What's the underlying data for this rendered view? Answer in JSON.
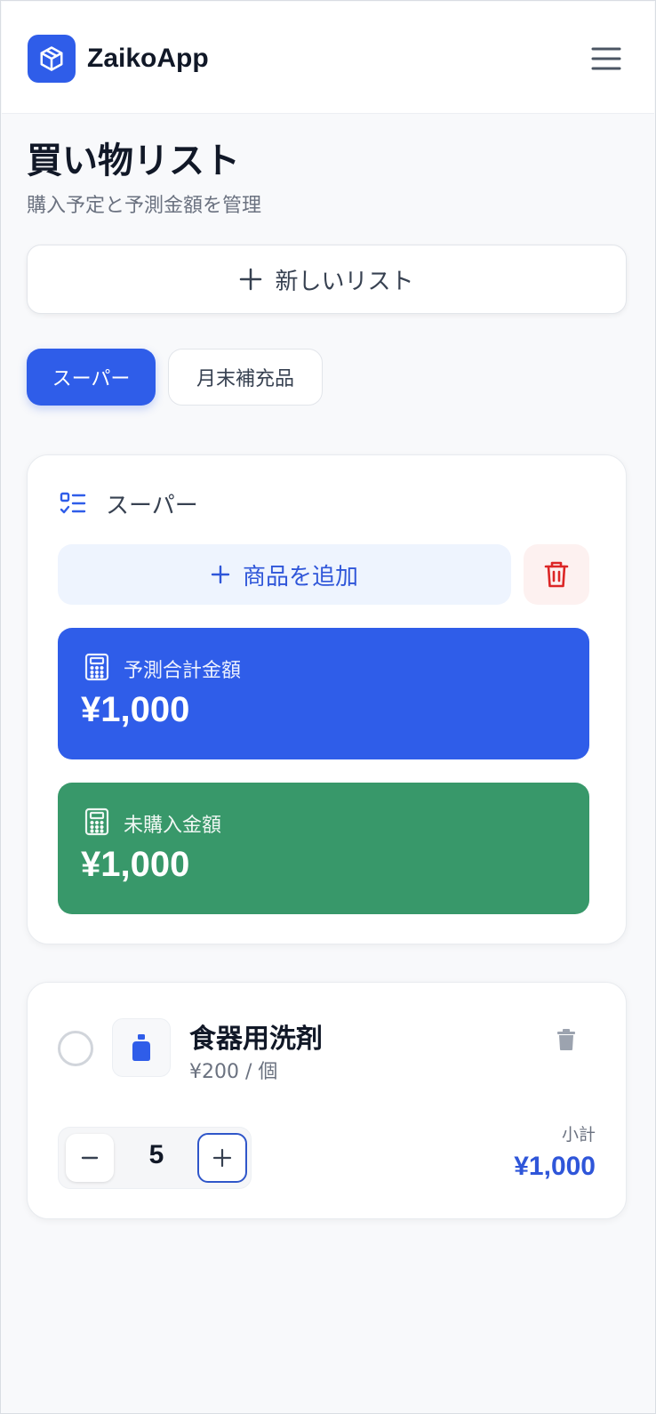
{
  "header": {
    "app_name": "ZaikoApp",
    "logo_icon": "box-icon",
    "menu_icon": "hamburger-menu-icon"
  },
  "page": {
    "title": "買い物リスト",
    "subtitle": "購入予定と予測金額を管理"
  },
  "new_list_button": {
    "icon": "plus-icon",
    "label": "新しいリスト"
  },
  "tabs": [
    {
      "label": "スーパー",
      "active": true
    },
    {
      "label": "月末補充品",
      "active": false
    }
  ],
  "list": {
    "name": "スーパー",
    "icon": "checklist-icon",
    "add_item_label": "商品を追加",
    "delete_icon": "trash-icon",
    "summary": {
      "predicted_total": {
        "label": "予測合計金額",
        "value": "¥1,000",
        "icon": "calculator-icon",
        "color": "#2f5de9"
      },
      "unpurchased_total": {
        "label": "未購入金額",
        "value": "¥1,000",
        "icon": "calculator-icon",
        "color": "#38986a"
      }
    }
  },
  "items": [
    {
      "name": "食器用洗剤",
      "price": "¥200 / 個",
      "icon": "detergent-bottle-icon",
      "quantity": "5",
      "subtotal_label": "小計",
      "subtotal": "¥1,000",
      "checked": false
    }
  ],
  "colors": {
    "accent": "#2f5de9",
    "success": "#38986a",
    "danger": "#dc2626"
  }
}
